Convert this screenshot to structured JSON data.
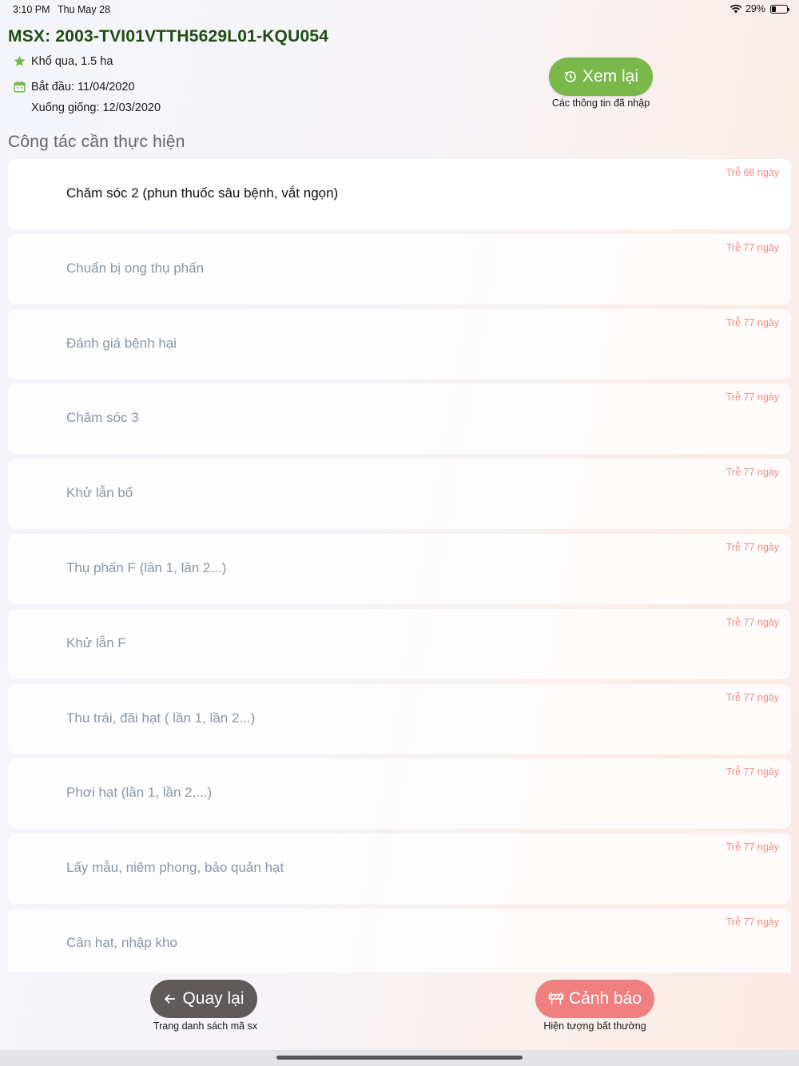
{
  "status_bar": {
    "time": "3:10 PM",
    "date": "Thu May 28",
    "battery": "29%"
  },
  "header": {
    "title": "MSX: 2003-TVI01VTTH5629L01-KQU054",
    "crop": "Khổ qua, 1.5 ha",
    "start_date": "Bắt đầu: 11/04/2020",
    "sowing_date": "Xuống giống: 12/03/2020"
  },
  "review": {
    "label": "Xem lại",
    "caption": "Các thông tin đã nhập"
  },
  "section_title": "Công tác cần thực hiện",
  "tasks": [
    {
      "label": "Chăm sóc 2 (phun thuốc sâu bệnh, vắt ngọn)",
      "late": "Trễ 68 ngày"
    },
    {
      "label": "Chuẩn bị ong thụ phấn",
      "late": "Trễ 77 ngày"
    },
    {
      "label": "Đánh giá bệnh hại",
      "late": "Trễ 77 ngày"
    },
    {
      "label": "Chăm sóc 3",
      "late": "Trễ 77 ngày"
    },
    {
      "label": "Khử lẫn bố",
      "late": "Trễ 77 ngày"
    },
    {
      "label": "Thụ phấn F (lần 1, lần 2...)",
      "late": "Trễ 77 ngày"
    },
    {
      "label": "Khử lẫn F",
      "late": "Trễ 77 ngày"
    },
    {
      "label": "Thu trái, đãi hạt ( lần 1, lần 2...)",
      "late": "Trễ 77 ngày"
    },
    {
      "label": "Phơi hạt (lần 1, lần 2,...)",
      "late": "Trễ 77 ngày"
    },
    {
      "label": "Lấy mẫu, niêm phong, bảo quản hạt",
      "late": "Trễ 77 ngày"
    },
    {
      "label": "Cân hạt, nhập kho",
      "late": "Trễ 77 ngày"
    }
  ],
  "back": {
    "label": "Quay lại",
    "caption": "Trang danh sách mã sx"
  },
  "warning": {
    "label": "Cảnh báo",
    "caption": "Hiện tượng bất thường"
  },
  "colors": {
    "title_green": "#1f4d12",
    "review_green": "#7ab84a",
    "back_gray": "#5f5a59",
    "warning_red": "#f0807f",
    "late_text": "#ef8d87"
  },
  "icons": {
    "crop": "star-icon",
    "start": "calendar-icon",
    "review": "history-icon",
    "back": "arrow-left-icon",
    "warning": "barrier-icon"
  }
}
